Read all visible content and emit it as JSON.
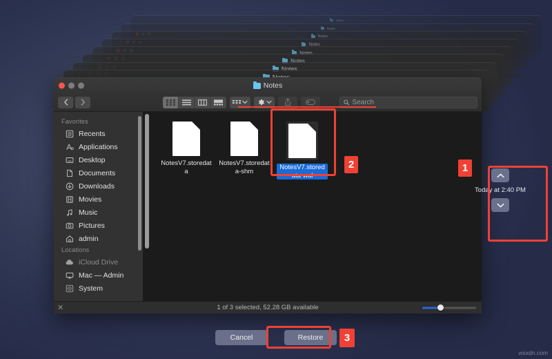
{
  "desktop": {
    "watermark": "wsxdn.com",
    "background_accent": "#3b4566"
  },
  "stack": {
    "window_title": "Notes",
    "count": 9
  },
  "finder": {
    "title": "Notes",
    "toolbar": {
      "back_icon": "chevron-left-icon",
      "forward_icon": "chevron-right-icon",
      "views": [
        {
          "name": "icon-view",
          "label": "Icon view",
          "active": true
        },
        {
          "name": "list-view",
          "label": "List view",
          "active": false
        },
        {
          "name": "column-view",
          "label": "Column view",
          "active": false
        },
        {
          "name": "gallery-view",
          "label": "Gallery view",
          "active": false
        }
      ],
      "group_label": "Group items",
      "action_label": "Action",
      "share_label": "Share",
      "tag_label": "Tags"
    },
    "search": {
      "placeholder": "Search",
      "value": ""
    },
    "sidebar": {
      "sections": [
        {
          "header": "Favorites",
          "items": [
            {
              "label": "Recents",
              "icon": "recents-icon"
            },
            {
              "label": "Applications",
              "icon": "applications-icon"
            },
            {
              "label": "Desktop",
              "icon": "desktop-icon"
            },
            {
              "label": "Documents",
              "icon": "documents-icon"
            },
            {
              "label": "Downloads",
              "icon": "downloads-icon"
            },
            {
              "label": "Movies",
              "icon": "movies-icon"
            },
            {
              "label": "Music",
              "icon": "music-icon"
            },
            {
              "label": "Pictures",
              "icon": "pictures-icon"
            },
            {
              "label": "admin",
              "icon": "home-icon"
            }
          ]
        },
        {
          "header": "Locations",
          "items": [
            {
              "label": "iCloud Drive",
              "icon": "cloud-icon"
            },
            {
              "label": "Mac — Admin",
              "icon": "computer-icon"
            },
            {
              "label": "System",
              "icon": "disk-icon"
            }
          ]
        }
      ]
    },
    "files": [
      {
        "name": "NotesV7.storedata",
        "selected": false,
        "icon": "document-icon"
      },
      {
        "name": "NotesV7.storedata-shm",
        "selected": false,
        "icon": "document-icon"
      },
      {
        "name": "NotesV7.storedata-wal",
        "selected": true,
        "icon": "document-icon"
      }
    ],
    "status": {
      "text": "1 of 3 selected, 52.28 GB available",
      "close_icon": "close-x-icon",
      "zoom_value": 28
    }
  },
  "timemachine": {
    "up_icon": "chevron-up-icon",
    "down_icon": "chevron-down-icon",
    "date_label": "Today at 2:40 PM"
  },
  "actions": {
    "cancel_label": "Cancel",
    "restore_label": "Restore"
  },
  "annotations": {
    "marker_color": "#f04134",
    "items": [
      {
        "number": "1",
        "target": "time-machine-navigator"
      },
      {
        "number": "2",
        "target": "selected-file"
      },
      {
        "number": "3",
        "target": "restore-button"
      }
    ]
  }
}
